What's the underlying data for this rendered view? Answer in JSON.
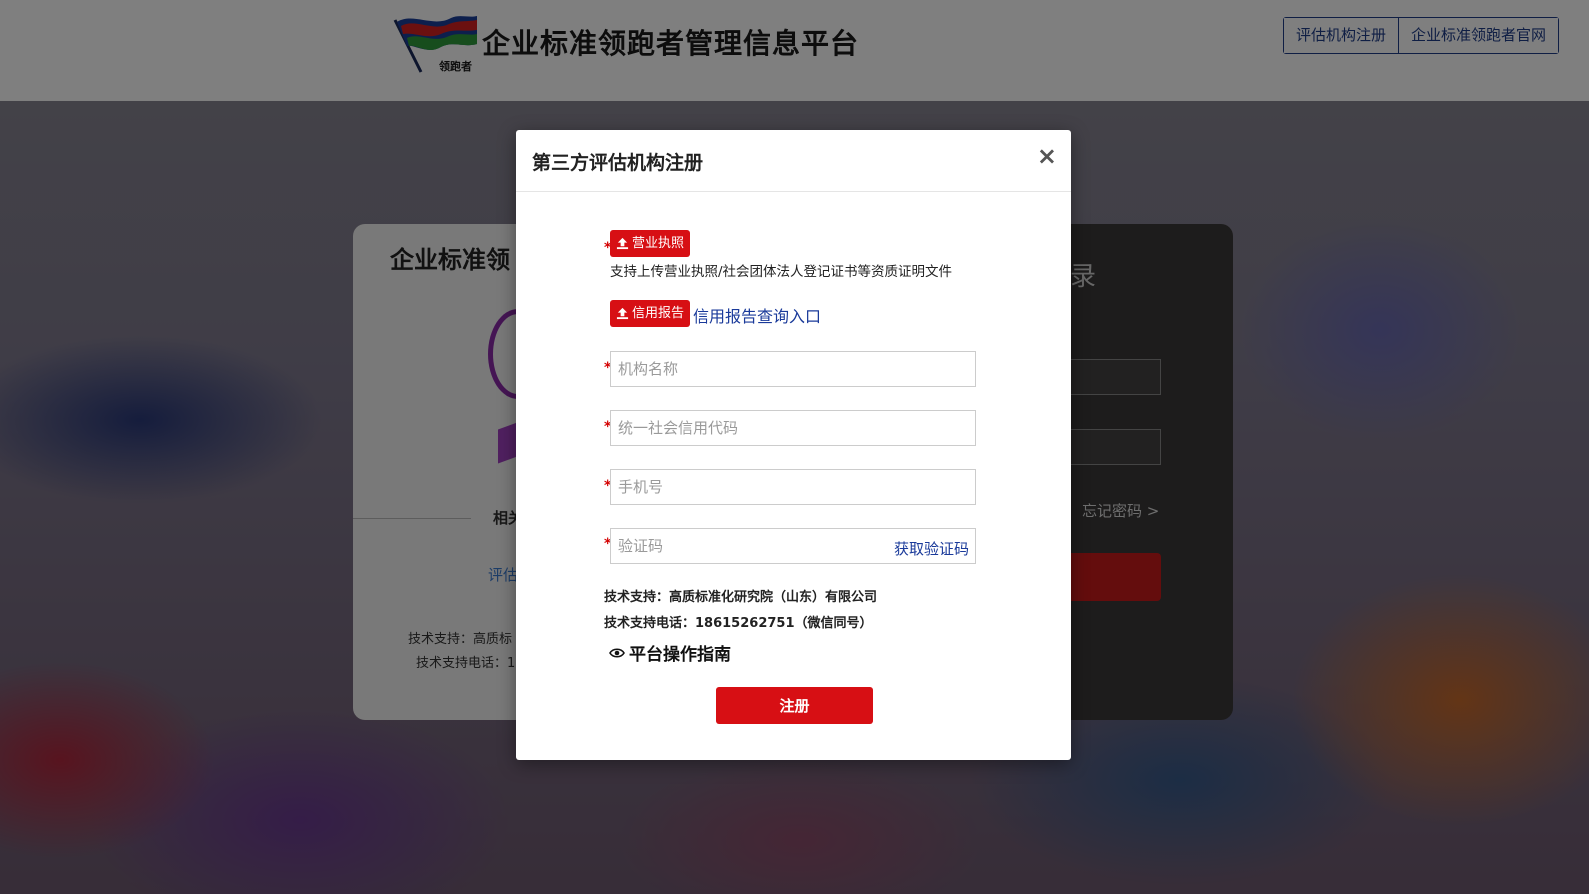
{
  "header": {
    "site_title": "企业标准领跑者管理信息平台",
    "logo_text": "领跑者",
    "links": [
      "评估机构注册",
      "企业标准领跑者官网"
    ]
  },
  "background": {
    "left_card": {
      "title": "企业标准领",
      "related_label": "相关",
      "eval_link": "评估",
      "support_line1": "技术支持：高质标",
      "support_line2": "技术支持电话：1"
    },
    "right_card": {
      "heading": "录",
      "forgot_password": "忘记密码 >"
    }
  },
  "modal": {
    "title": "第三方评估机构注册",
    "close_icon": "close-icon",
    "business_license_button": "营业执照",
    "business_license_hint": "支持上传营业执照/社会团体法人登记证书等资质证明文件",
    "credit_report_button": "信用报告",
    "credit_report_link": "信用报告查询入口",
    "fields": {
      "org_name": {
        "placeholder": "机构名称",
        "value": ""
      },
      "credit_code": {
        "placeholder": "统一社会信用代码",
        "value": ""
      },
      "phone": {
        "placeholder": "手机号",
        "value": ""
      },
      "verify_code": {
        "placeholder": "验证码",
        "value": ""
      }
    },
    "get_code_label": "获取验证码",
    "support_line1": "技术支持：高质标准化研究院（山东）有限公司",
    "support_line2": "技术支持电话：18615262751（微信同号）",
    "guide_label": "平台操作指南",
    "submit_label": "注册",
    "required_marker": "*"
  },
  "colors": {
    "accent_red": "#d70f14",
    "link_blue": "#1a3a9a",
    "header_border": "#1f3c88"
  }
}
